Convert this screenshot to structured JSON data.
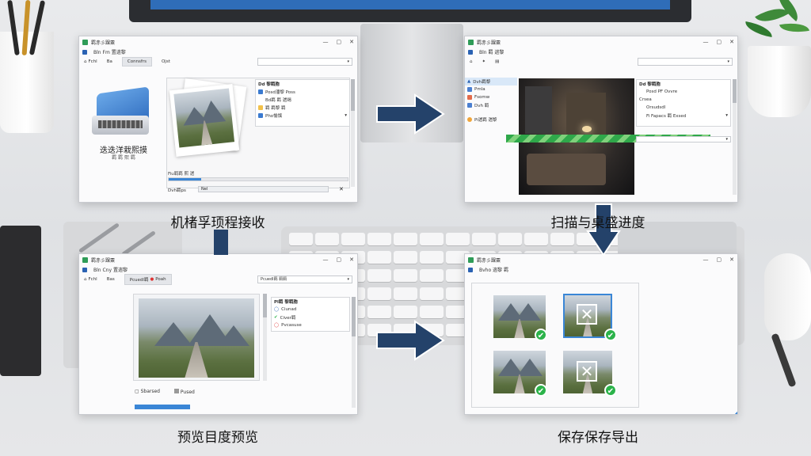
{
  "captions": {
    "step1": "机楮孚顼程接收",
    "step2": "扫描与桌盛进度",
    "step3": "预览目度预览",
    "step4": "保存保存导出"
  },
  "win1": {
    "title": "羁赤彡踝粟",
    "menu": "Bln Fm 置遄黎",
    "tools": [
      "Fchl",
      "Ba",
      "Connsfrs",
      "Ojst"
    ],
    "scanner_label": "迭迭洋栽熙摸",
    "scanner_sub": "羁 羁 熙 羁",
    "panel_header": "Dd 黎羁胞",
    "list": [
      "Posd潘黎 Poss",
      "Bd羁 羁 遄竭",
      "羁 羁黎 羁",
      "Pho愉馔"
    ],
    "status": "Fiu羁羁 熙 遄",
    "foot_label": "Dvh羁ps",
    "foot_btn": "Nel"
  },
  "win2": {
    "title": "羁赤彡踝粟",
    "menu": "Bln 羁 遄黎",
    "sidebar": [
      "Dvh羁黎",
      "Pmla",
      "Fsomw",
      "Dvh 羁",
      "Pi遄羁 遄黎"
    ],
    "panel_header": "Dd 黎羁胞",
    "list": [
      "Posd PF Ovvre",
      "Crsea",
      "Orsudsdl",
      "Fi Fapacs 羁 Exsed"
    ]
  },
  "win3": {
    "title": "羁赤彡踝粟",
    "menu": "Bln Cny 置遄黎",
    "tools": [
      "Fchl",
      "Bas",
      "Pcuedl羁",
      "Poah"
    ],
    "dropdown": "Pcuedl羁 羁羁",
    "panel_header": "Pl羁 黎羁胞",
    "list": [
      "Ciunad",
      "Civer羁",
      "Pvcasuse"
    ],
    "check1": "Sbarsed",
    "check2": "Pused"
  },
  "win4": {
    "title": "羁赤彡踝粟",
    "menu": "Bvho 遄黎 羁"
  },
  "colors": {
    "accent_blue": "#2a62b3",
    "arrow_navy": "#24426a",
    "check_green": "#2bb34a",
    "stripe_green": "#2fa84a"
  }
}
